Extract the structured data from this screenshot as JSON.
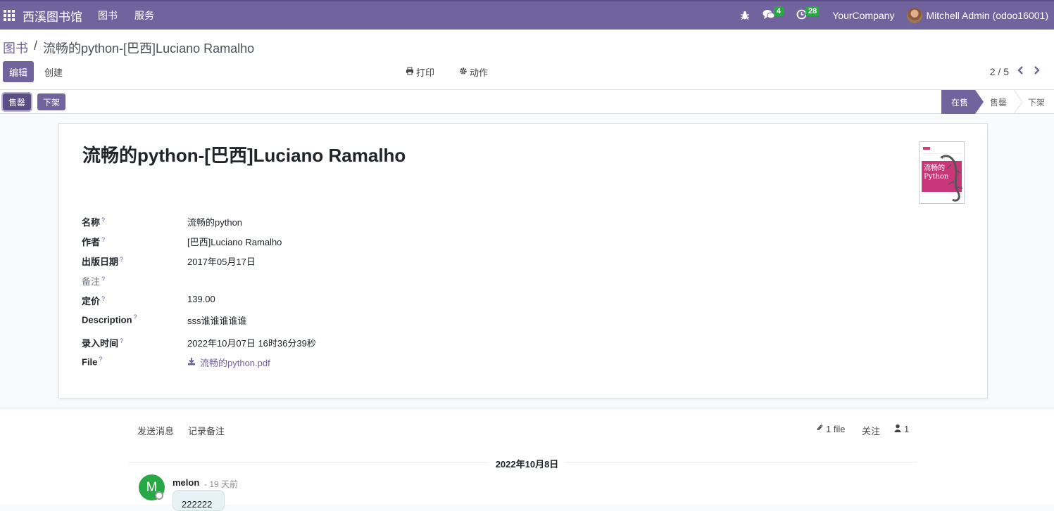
{
  "navbar": {
    "brand": "西溪图书馆",
    "menus": [
      "图书",
      "服务"
    ],
    "messages_count": "4",
    "activities_count": "28",
    "company": "YourCompany",
    "user": "Mitchell Admin (odoo16001)"
  },
  "breadcrumb": {
    "parent": "图书",
    "separator": "/",
    "current": "流畅的python-[巴西]Luciano Ramalho"
  },
  "toolbar": {
    "edit_label": "编辑",
    "create_label": "创建",
    "print_label": "打印",
    "action_label": "动作",
    "pager": "2 / 5"
  },
  "statusbar": {
    "buttons": [
      "售罄",
      "下架"
    ],
    "stages": [
      "在售",
      "售罄",
      "下架"
    ],
    "current_stage": "在售"
  },
  "record": {
    "title": "流畅的python-[巴西]Luciano Ramalho",
    "cover_text": [
      "流畅的",
      "Python"
    ],
    "fields": [
      {
        "label": "名称",
        "value": "流畅的python"
      },
      {
        "label": "作者",
        "value": "[巴西]Luciano Ramalho"
      },
      {
        "label": "出版日期",
        "value": "2017年05月17日"
      },
      {
        "label": "备注",
        "value": ""
      },
      {
        "label": "定价",
        "value": "139.00"
      },
      {
        "label": "Description",
        "value": "sss谁谁谁谁谁"
      },
      {
        "label": "录入时间",
        "value": "2022年10月07日 16时36分39秒"
      },
      {
        "label": "File",
        "value": "流畅的python.pdf"
      }
    ],
    "help_mark": "?"
  },
  "chatter": {
    "send_message": "发送消息",
    "log_note": "记录备注",
    "attachments": "1 file",
    "follow": "关注",
    "followers": "1",
    "date_label": "2022年10月8日",
    "message": {
      "avatar_letter": "M",
      "author": "melon",
      "time": "- 19 天前",
      "body": "222222"
    }
  },
  "colors": {
    "primary": "#71639e",
    "success": "#28a745"
  }
}
